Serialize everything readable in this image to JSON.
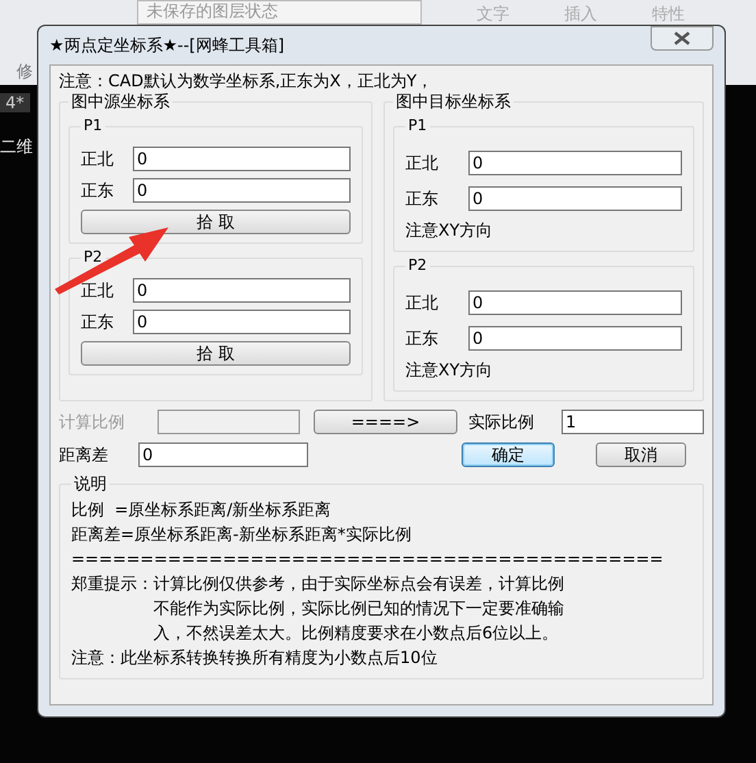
{
  "background": {
    "layer_state": "未保存的图层状态",
    "toolbar_labels": [
      "文字",
      "插入",
      "特性"
    ],
    "panel_label": "修",
    "tab": "4*",
    "side_text": "二维"
  },
  "dialog": {
    "title": "★两点定坐标系★--[网蜂工具箱]",
    "note": "注意：CAD默认为数学坐标系,正东为X，正北为Y，",
    "groups": [
      {
        "title": "图中源坐标系",
        "kind": "pick",
        "points": [
          {
            "label": "P1",
            "fields": [
              {
                "label": "正北",
                "value": "0"
              },
              {
                "label": "正东",
                "value": "0"
              }
            ],
            "button": "拾 取"
          },
          {
            "label": "P2",
            "fields": [
              {
                "label": "正北",
                "value": "0"
              },
              {
                "label": "正东",
                "value": "0"
              }
            ],
            "button": "拾 取"
          }
        ]
      },
      {
        "title": "图中目标坐标系",
        "kind": "hint",
        "points": [
          {
            "label": "P1",
            "fields": [
              {
                "label": "正北",
                "value": "0"
              },
              {
                "label": "正东",
                "value": "0"
              }
            ],
            "hint": "注意XY方向"
          },
          {
            "label": "P2",
            "fields": [
              {
                "label": "正北",
                "value": "0"
              },
              {
                "label": "正东",
                "value": "0"
              }
            ],
            "hint": "注意XY方向"
          }
        ]
      }
    ],
    "calc": {
      "label": "计算比例",
      "disabled": true
    },
    "transfer_button": "====>",
    "actual": {
      "label": "实际比例",
      "value": "1"
    },
    "distance": {
      "label": "距离差",
      "value": "0"
    },
    "buttons": [
      {
        "label": "确定",
        "default": true
      },
      {
        "label": "取消",
        "default": false
      }
    ],
    "explanation": {
      "title": "说明",
      "lines": [
        "比例  =原坐标系距离/新坐标系距离",
        "距离差=原坐标系距离-新坐标系距离*实际比例",
        "==========================================="
      ],
      "tip": {
        "label": "郑重提示：",
        "lines": [
          "计算比例仅供参考，由于实际坐标点会有误差，计算比例",
          "不能作为实际比例，实际比例已知的情况下一定要准确输",
          "入，不然误差太大。比例精度要求在小数点后6位以上。"
        ]
      },
      "footer": "注意：此坐标系转换转换所有精度为小数点后10位"
    }
  }
}
